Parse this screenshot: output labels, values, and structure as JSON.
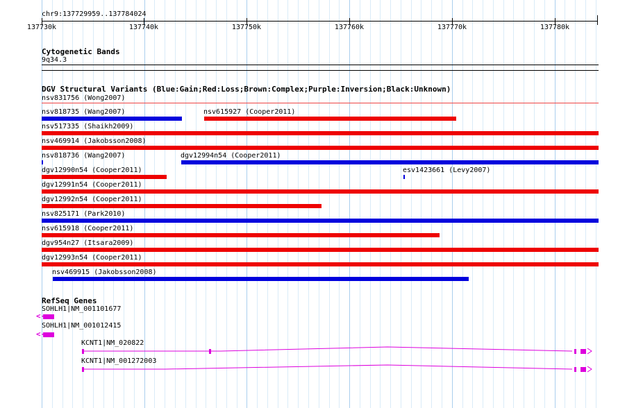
{
  "ruler": {
    "location": "chr9:137729959..137784024",
    "tick_labels": [
      "137730k",
      "137740k",
      "137750k",
      "137760k",
      "137770k",
      "137780k"
    ]
  },
  "cytobands": {
    "title": "Cytogenetic Bands",
    "band": "9q34.3"
  },
  "dgv": {
    "title": "DGV Structural Variants (Blue:Gain;Red:Loss;Brown:Complex;Purple:Inversion;Black:Unknown)",
    "colors": {
      "gain": "#0000dd",
      "loss": "#ee0000",
      "thin_loss": "#ee4444"
    },
    "variants": [
      {
        "name": "nsv831756 (Wong2007)",
        "type": "loss"
      },
      {
        "name": "nsv818735 (Wang2007)",
        "type": "gain"
      },
      {
        "name": "nsv615927 (Cooper2011)",
        "type": "loss"
      },
      {
        "name": "nsv517335 (Shaikh2009)",
        "type": "loss"
      },
      {
        "name": "nsv469914 (Jakobsson2008)",
        "type": "loss"
      },
      {
        "name": "nsv818736 (Wang2007)",
        "type": "gain"
      },
      {
        "name": "dgv12994n54 (Cooper2011)",
        "type": "gain"
      },
      {
        "name": "dgv12990n54 (Cooper2011)",
        "type": "loss"
      },
      {
        "name": "esv1423661 (Levy2007)",
        "type": "gain"
      },
      {
        "name": "dgv12991n54 (Cooper2011)",
        "type": "loss"
      },
      {
        "name": "dgv12992n54 (Cooper2011)",
        "type": "loss"
      },
      {
        "name": "nsv825171 (Park2010)",
        "type": "gain"
      },
      {
        "name": "nsv615918 (Cooper2011)",
        "type": "loss"
      },
      {
        "name": "dgv954n27 (Itsara2009)",
        "type": "loss"
      },
      {
        "name": "dgv12993n54 (Cooper2011)",
        "type": "loss"
      },
      {
        "name": "nsv469915 (Jakobsson2008)",
        "type": "gain"
      }
    ]
  },
  "refseq": {
    "title": "RefSeq Genes",
    "color": "#dd00dd",
    "genes": [
      {
        "name": "SOHLH1|NM_001101677"
      },
      {
        "name": "SOHLH1|NM_001012415"
      },
      {
        "name": "KCNT1|NM_020822"
      },
      {
        "name": "KCNT1|NM_001272003"
      }
    ]
  }
}
